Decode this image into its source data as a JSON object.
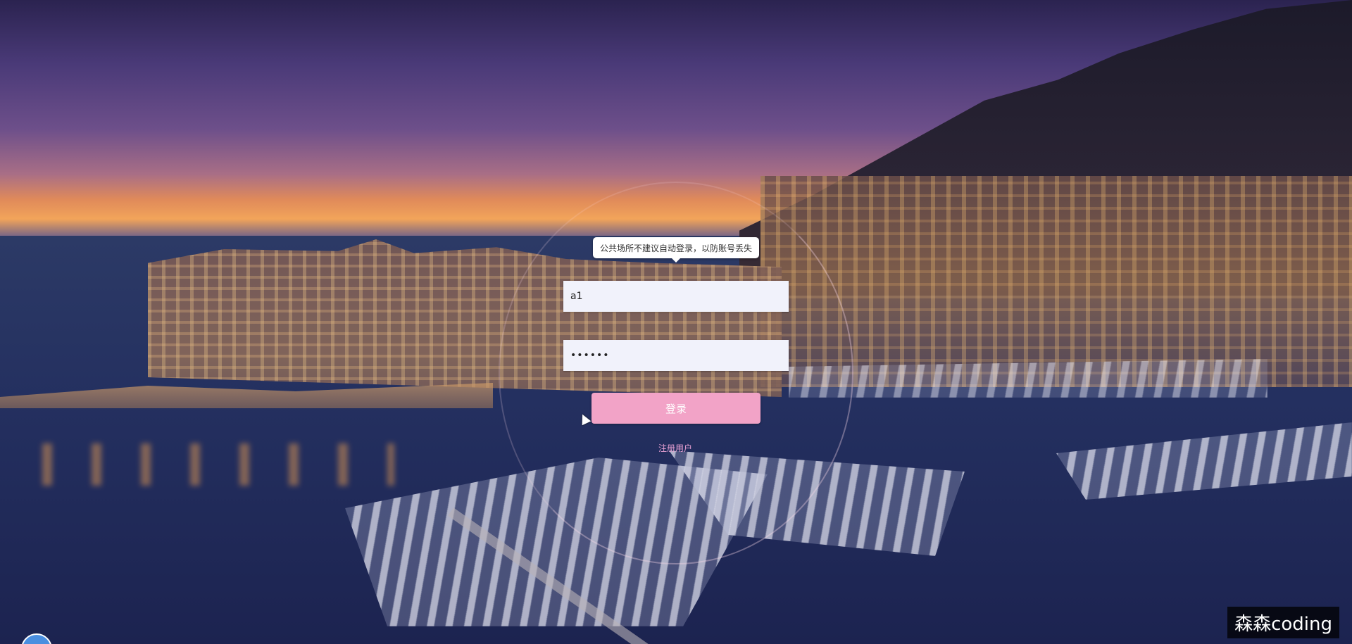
{
  "login": {
    "tooltip": "公共场所不建议自动登录，以防账号丢失",
    "username_value": "a1",
    "password_value": "••••••",
    "login_button": "登录",
    "register_link": "注册用户"
  },
  "watermark": "森森coding",
  "colors": {
    "login_button": "#f2a3c7",
    "register_link": "#e7a0d3",
    "input_background": "#f1f2fb"
  }
}
